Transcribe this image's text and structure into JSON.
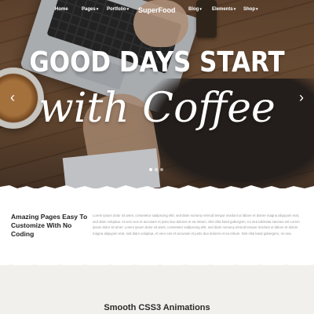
{
  "nav": {
    "items_left": [
      {
        "label": "Home",
        "dropdown": false
      },
      {
        "label": "Pages",
        "dropdown": true
      },
      {
        "label": "Portfolio",
        "dropdown": true
      }
    ],
    "logo": "SuperFood",
    "items_right": [
      {
        "label": "Blog",
        "dropdown": true
      },
      {
        "label": "Elements",
        "dropdown": true
      },
      {
        "label": "Shop",
        "dropdown": true
      }
    ],
    "caret": "▾"
  },
  "hero": {
    "headline_line1": "GOOD DAYS START",
    "headline_line2": "with Coffee",
    "prev_arrow": "‹",
    "next_arrow": "›",
    "slide_count": 3,
    "active_slide": 1
  },
  "feature": {
    "title": "Amazing Pages Easy To Customize With No Coding",
    "body": "Lorem ipsum dolor sit amet, consetetur sadipscing elitr, sed diam nonumy eirmod tempor invidunt ut labore et dolore magna aliquyam erat, sed diam voluptua. At vero eos et accusam et justo duo dolores et ea rebum. Stet clita kasd gubergren, no sea takimata sanctus est Lorem ipsum dolor sit amet. Lorem ipsum dolor sit amet, consetetur sadipscing elitr, sed diam nonumy eirmod tempor invidunt ut labore et dolore magna aliquyam erat, sed diam voluptua. At vero eos et accusam et justo duo dolores et ea rebum. Stet clita kasd gubergren, no sea."
  },
  "section2": {
    "heading": "Smooth CSS3 Animations"
  },
  "colors": {
    "text_dark": "#1f1f1f",
    "text_muted": "#9a9a9a",
    "section_bg": "#f2f0ec"
  }
}
